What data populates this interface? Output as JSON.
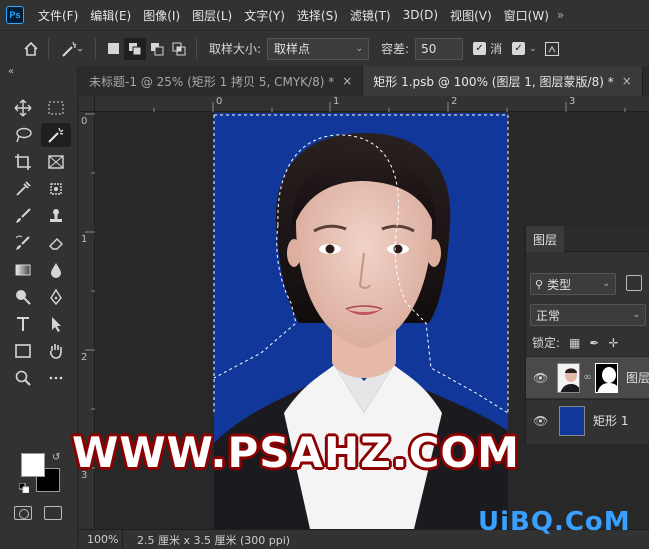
{
  "app": {
    "logo_text": "Ps"
  },
  "menu": {
    "items": [
      "文件(F)",
      "编辑(E)",
      "图像(I)",
      "图层(L)",
      "文字(Y)",
      "选择(S)",
      "滤镜(T)",
      "3D(D)",
      "视图(V)",
      "窗口(W)"
    ],
    "overflow": "»"
  },
  "options": {
    "sample_size_label": "取样大小:",
    "sample_size_value": "取样点",
    "tolerance_label": "容差:",
    "tolerance_value": "50",
    "antialias_label": "消"
  },
  "tabs": [
    {
      "label": "未标题-1 @ 25% (矩形 1 拷贝 5, CMYK/8) *",
      "active": false
    },
    {
      "label": "矩形 1.psb @ 100% (图层 1, 图层蒙版/8) *",
      "active": true
    }
  ],
  "ruler": {
    "top": [
      "0",
      "1",
      "2",
      "3"
    ],
    "left": [
      "0",
      "1",
      "2",
      "3"
    ]
  },
  "watermark": {
    "text": "WWW.PSAHZ.COM"
  },
  "site_logo": "UiBQ.CoM",
  "layers_panel": {
    "tab_label": "图层",
    "filter_label": "类型",
    "blend_mode": "正常",
    "lock_label": "锁定:",
    "layers": [
      {
        "name": "图层",
        "selected": true
      },
      {
        "name": "矩形 1",
        "selected": false
      }
    ]
  },
  "status": {
    "zoom": "100%",
    "doc_info": "2.5 厘米 x 3.5 厘米 (300 ppi)"
  },
  "colors": {
    "background_blue": "#12379a",
    "accent": "#31a8ff",
    "watermark_outline": "#8b0000"
  }
}
